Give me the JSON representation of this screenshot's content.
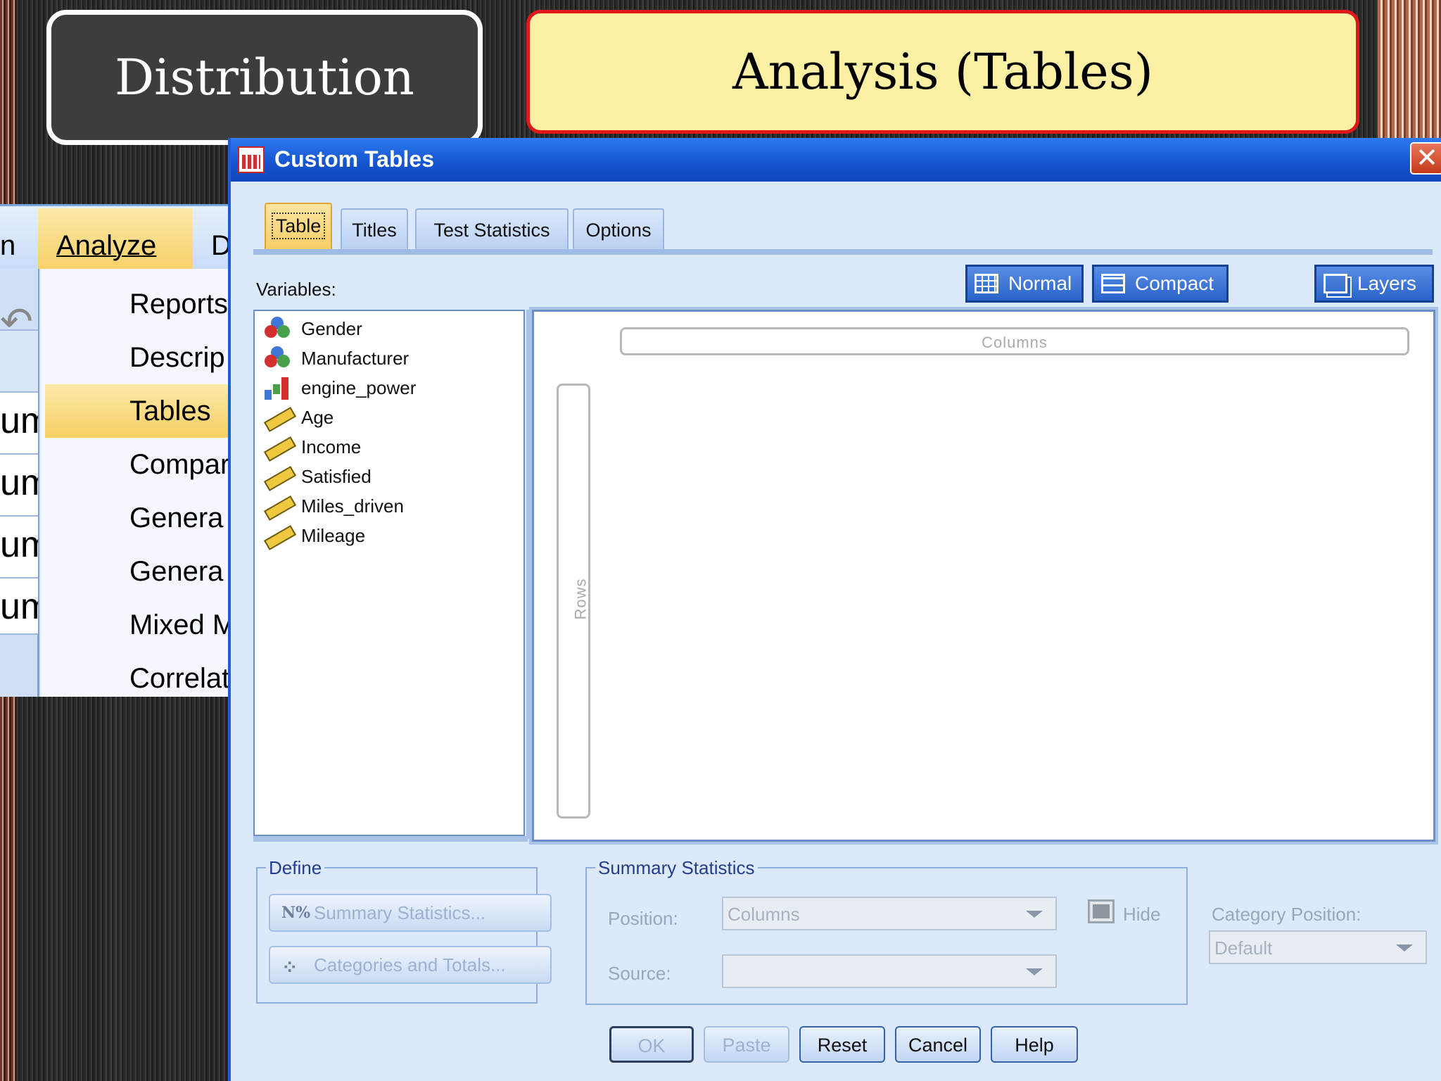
{
  "slide": {
    "left_header": "Distribution",
    "right_header": "Analysis (Tables)"
  },
  "menu": {
    "bar_left_fragment": "n",
    "bar_item": "Analyze",
    "bar_next_fragment": "D",
    "left_column_fragments": [
      "um",
      "um",
      "um",
      "um"
    ],
    "items": [
      "Reports",
      "Descrip",
      "Tables",
      "Compar",
      "Genera",
      "Genera",
      "Mixed M",
      "Correlat"
    ]
  },
  "dialog": {
    "title": "Custom Tables",
    "close_glyph": "✕",
    "tabs": [
      "Table",
      "Titles",
      "Test Statistics",
      "Options"
    ],
    "variables_label": "Variables:",
    "view_buttons": {
      "normal": "Normal",
      "compact": "Compact",
      "layers": "Layers"
    },
    "variables": [
      {
        "name": "Gender",
        "icon": "nominal-icon"
      },
      {
        "name": "Manufacturer",
        "icon": "nominal-icon"
      },
      {
        "name": "engine_power",
        "icon": "ordinal-icon"
      },
      {
        "name": "Age",
        "icon": "scale-ruler-icon"
      },
      {
        "name": "Income",
        "icon": "scale-ruler-icon"
      },
      {
        "name": "Satisfied",
        "icon": "scale-ruler-icon"
      },
      {
        "name": "Miles_driven",
        "icon": "scale-ruler-icon"
      },
      {
        "name": "Mileage",
        "icon": "scale-ruler-icon"
      }
    ],
    "canvas": {
      "columns_label": "Columns",
      "rows_label": "Rows"
    },
    "define": {
      "legend": "Define",
      "summary_statistics": "Summary Statistics...",
      "summary_icon_text": "N%",
      "categories_and_totals": "Categories and Totals..."
    },
    "summary_statistics_group": {
      "legend": "Summary Statistics",
      "position_label": "Position:",
      "position_value": "Columns",
      "hide_label": "Hide",
      "source_label": "Source:",
      "source_value": ""
    },
    "category_position": {
      "label": "Category Position:",
      "value": "Default"
    },
    "buttons": {
      "ok": "OK",
      "paste": "Paste",
      "reset": "Reset",
      "cancel": "Cancel",
      "help": "Help"
    }
  },
  "colors": {
    "titlebar": "#1453cf",
    "active_tab": "#f7cc62",
    "header_dark": "#3d3d3d",
    "header_yellow": "#fbf0a4",
    "header_red_border": "#e01818"
  }
}
